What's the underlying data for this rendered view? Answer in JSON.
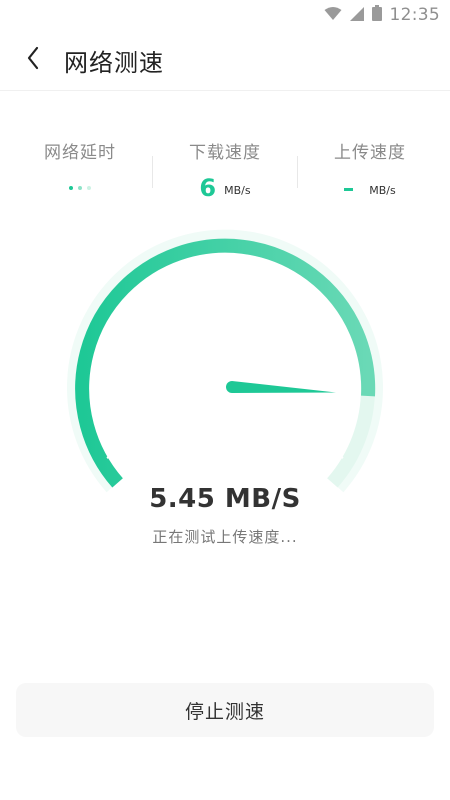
{
  "status_bar": {
    "time": "12:35",
    "icons": [
      "wifi-icon",
      "signal-icon",
      "battery-icon"
    ]
  },
  "header": {
    "title": "网络测速",
    "back_icon": "chevron-left-icon"
  },
  "stats": {
    "latency": {
      "label": "网络延时",
      "state": "loading"
    },
    "download": {
      "label": "下载速度",
      "value": "6",
      "unit": "MB/s"
    },
    "upload": {
      "label": "上传速度",
      "value": "-",
      "unit": "MB/s"
    }
  },
  "gauge": {
    "speed_text": "5.45 MB/S",
    "status": "正在测试上传速度...",
    "progress": 0.82
  },
  "actions": {
    "stop_label": "停止测速"
  },
  "colors": {
    "accent": "#1ec896",
    "accent_light": "#7be0c2",
    "track": "#e6f8f1"
  }
}
